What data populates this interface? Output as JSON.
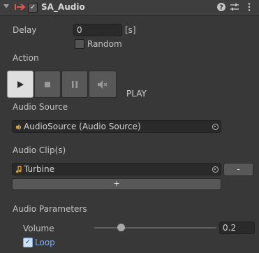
{
  "header": {
    "title": "SA_Audio",
    "enabled": true,
    "icons": [
      "foldout-arrow-icon",
      "script-icon",
      "help-icon",
      "preset-sliders-icon",
      "more-options-icon"
    ]
  },
  "delay": {
    "label": "Delay",
    "value": "0",
    "unit": "[s]",
    "random_label": "Random",
    "random_checked": false
  },
  "action": {
    "label": "Action",
    "buttons": [
      "play-icon",
      "stop-icon",
      "pause-icon",
      "mute-icon"
    ],
    "state": "PLAY"
  },
  "audio_source": {
    "label": "Audio Source",
    "value": "AudioSource (Audio Source)"
  },
  "audio_clips": {
    "label": "Audio Clip(s)",
    "items": [
      {
        "value": "Turbine"
      }
    ],
    "remove_label": "-",
    "add_label": "+"
  },
  "parameters": {
    "label": "Audio Parameters",
    "volume_label": "Volume",
    "volume_value": "0.2",
    "volume_fraction": 0.2,
    "loop_label": "Loop",
    "loop_checked": true
  },
  "colors": {
    "accent_blue": "#7faee6",
    "label_blue": "#80b0f0",
    "background": "#383838"
  }
}
